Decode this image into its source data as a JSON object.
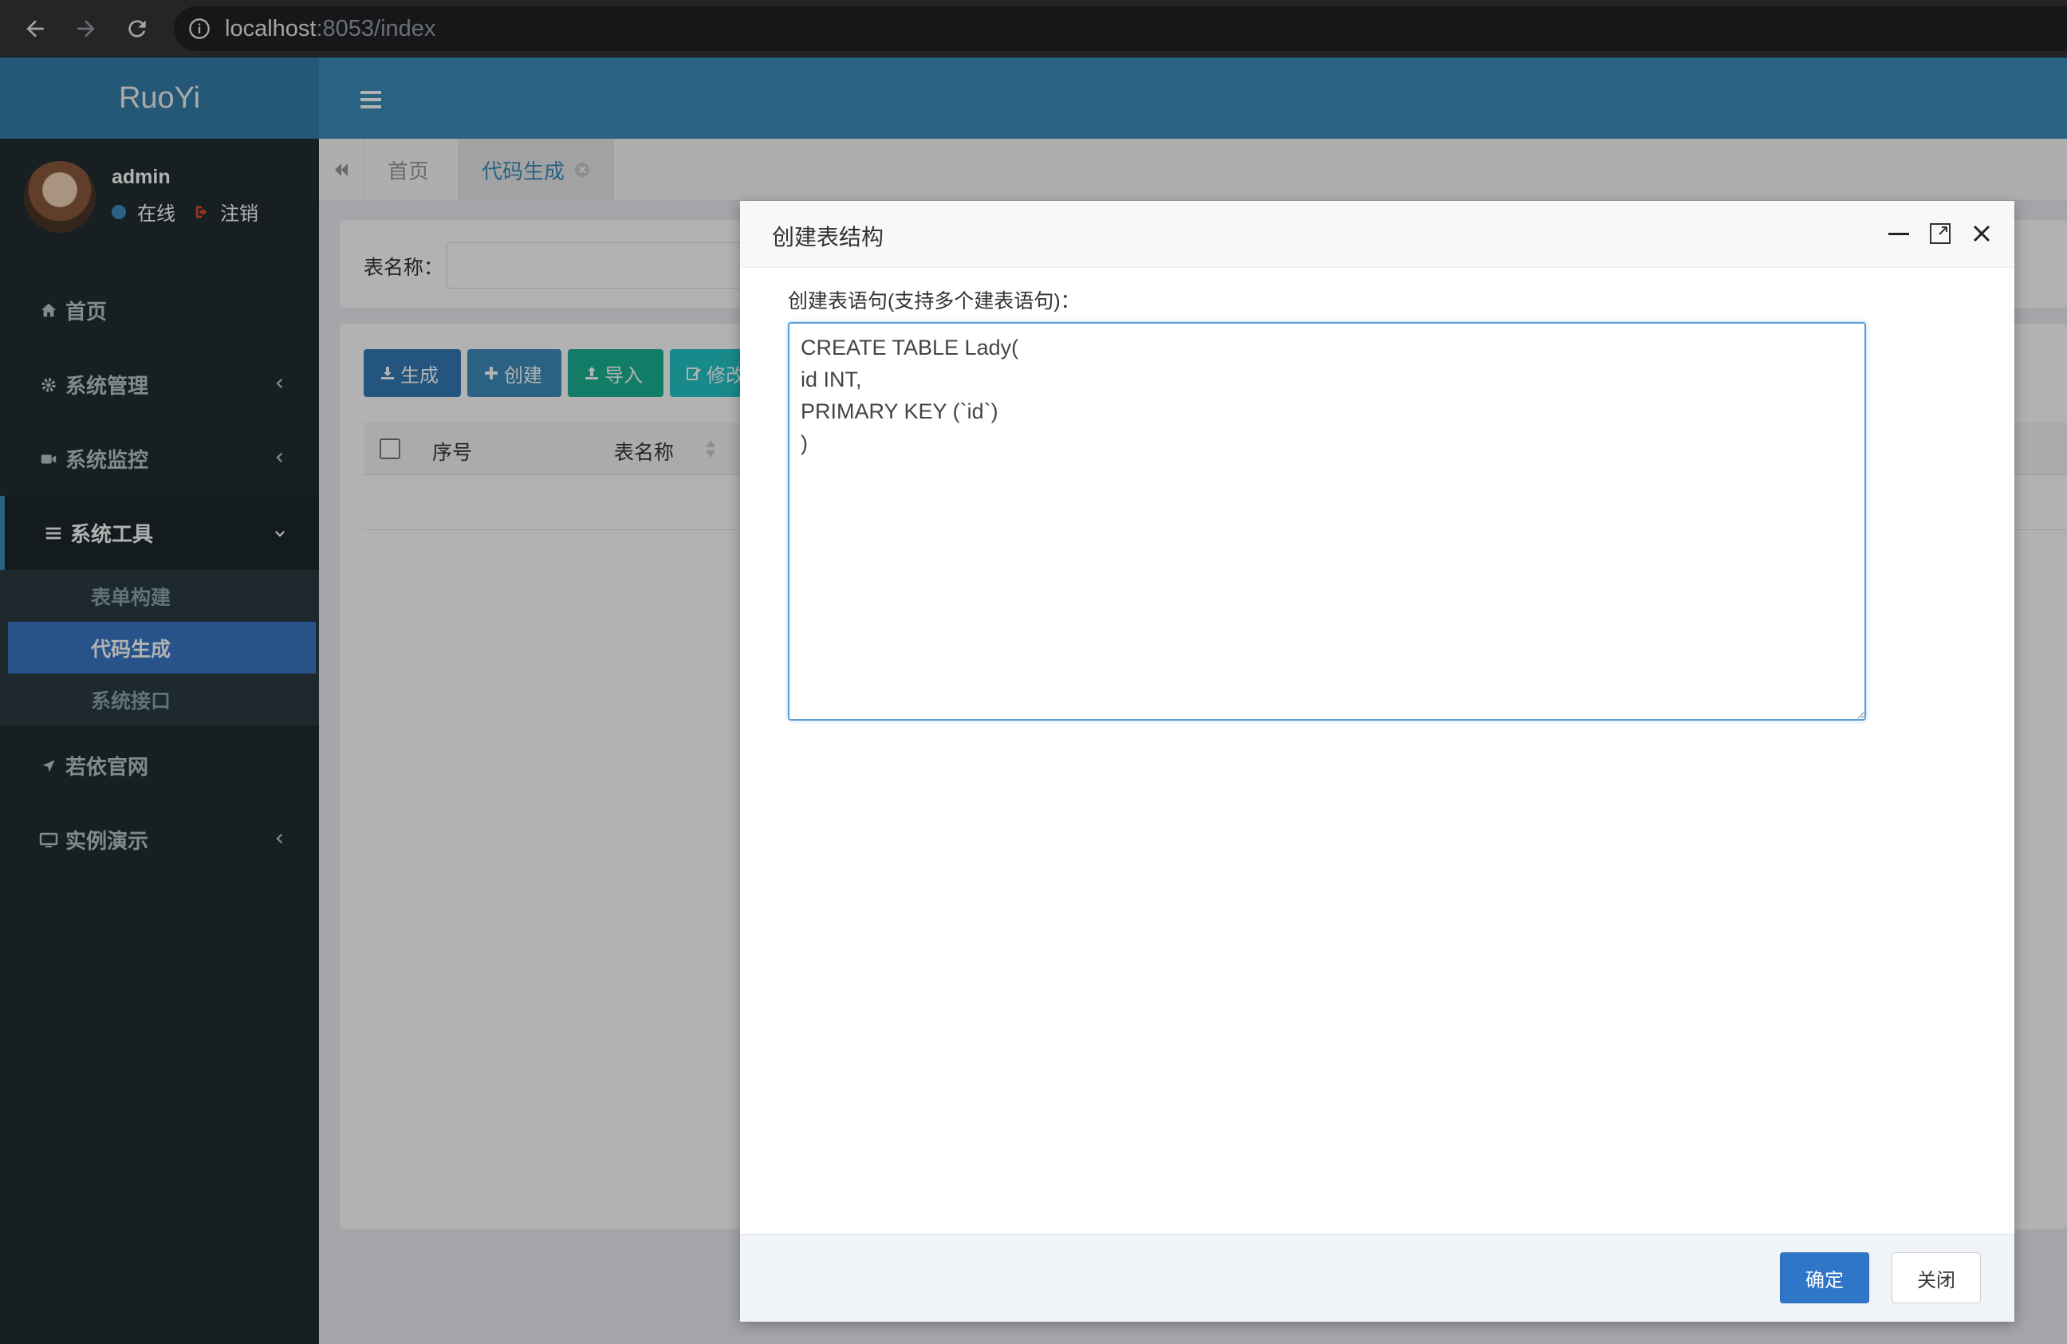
{
  "browser": {
    "url_host": "localhost",
    "url_rest": ":8053/index"
  },
  "sidebar": {
    "logo": "RuoYi",
    "user": {
      "name": "admin",
      "status": "在线",
      "logout": "注销"
    },
    "menu": [
      {
        "label": "首页",
        "icon": "home-icon"
      },
      {
        "label": "系统管理",
        "icon": "gear-icon"
      },
      {
        "label": "系统监控",
        "icon": "video-camera-icon"
      },
      {
        "label": "系统工具",
        "icon": "list-icon",
        "open": true,
        "children": [
          {
            "label": "表单构建"
          },
          {
            "label": "代码生成",
            "active": true
          },
          {
            "label": "系统接口"
          }
        ]
      },
      {
        "label": "若依官网",
        "icon": "location-arrow-icon"
      },
      {
        "label": "实例演示",
        "icon": "desktop-icon"
      }
    ]
  },
  "tabs": [
    {
      "label": "首页"
    },
    {
      "label": "代码生成",
      "active": true
    }
  ],
  "search": {
    "table_name_label": "表名称："
  },
  "toolbar": {
    "generate": "生成",
    "create": "创建",
    "import": "导入",
    "edit": "修改"
  },
  "table": {
    "headers": [
      "序号",
      "表名称"
    ]
  },
  "modal": {
    "title": "创建表结构",
    "field_label": "创建表语句(支持多个建表语句)：",
    "sql": "CREATE TABLE Lady(\nid INT,\nPRIMARY KEY (`id`)\n)",
    "ok": "确定",
    "close": "关闭"
  },
  "colors": {
    "primary": "#3c8dbc",
    "sidebar": "#222d32",
    "active_menu": "#3a78c6",
    "ok_button": "#2f76c9"
  }
}
